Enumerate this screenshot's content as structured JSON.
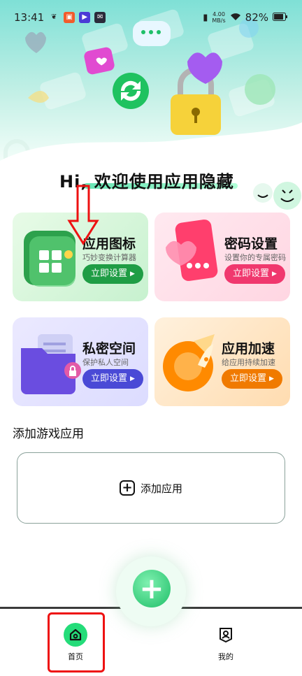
{
  "status_bar": {
    "time": "13:41",
    "net_speed_value": "4.00",
    "net_speed_unit": "MB/s",
    "battery": "82%"
  },
  "greeting": "Hi, 欢迎使用应用隐藏",
  "cards": [
    {
      "title": "应用图标",
      "subtitle": "巧妙变换计算器",
      "button": "立即设置",
      "accent": "#1f9d45"
    },
    {
      "title": "密码设置",
      "subtitle": "设置你的专属密码",
      "button": "立即设置",
      "accent": "#f0386e"
    },
    {
      "title": "私密空间",
      "subtitle": "保护私人空间",
      "button": "立即设置",
      "accent": "#4a4ad6"
    },
    {
      "title": "应用加速",
      "subtitle": "给应用持续加速",
      "button": "立即设置",
      "accent": "#f07a00"
    }
  ],
  "section": {
    "title": "添加游戏应用",
    "add_app_label": "添加应用"
  },
  "bottom_nav": {
    "home_label": "首页",
    "mine_label": "我的"
  },
  "icons": {
    "home": "home-icon",
    "mine": "profile-icon",
    "fab": "plus-icon",
    "arrow": "down-arrow-annotation-icon"
  },
  "colors": {
    "primary": "#24dc79",
    "annotation": "#e11111"
  }
}
